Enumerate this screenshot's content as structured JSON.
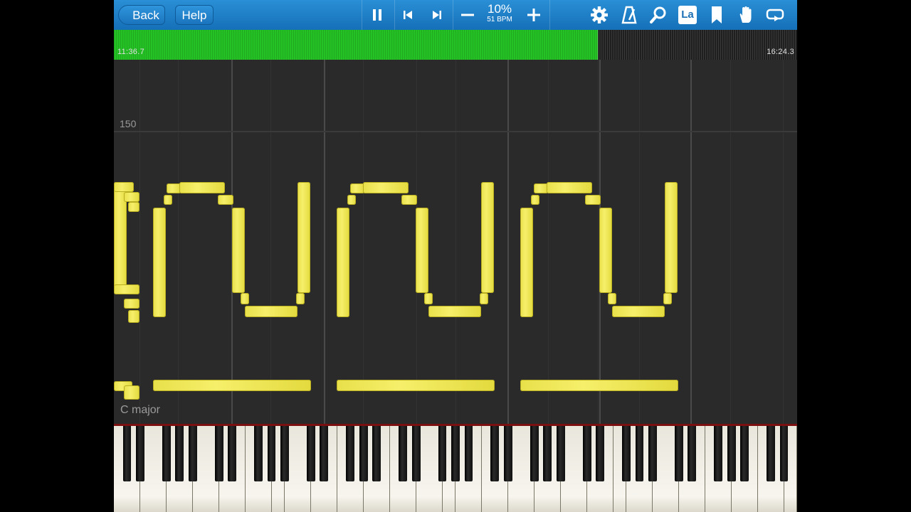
{
  "toolbar": {
    "back_label": "Back",
    "help_label": "Help",
    "speed_percent": "10%",
    "speed_bpm": "51 BPM",
    "icons": [
      "pause-icon",
      "previous-icon",
      "next-icon",
      "minus-icon",
      "plus-icon",
      "gear-icon",
      "metronome-icon",
      "magnifier-icon",
      "label-icon",
      "bookmark-icon",
      "hand-icon",
      "loop-icon"
    ],
    "label_icon_text": "La"
  },
  "progress": {
    "current_time": "11:36.7",
    "total_time": "16:24.3",
    "fraction": 0.707
  },
  "roll": {
    "measure_number": "150",
    "key_signature": "C major",
    "note_color": "#f2ea5a"
  },
  "colors": {
    "toolbar": "#1a7bc4",
    "progress_played": "#22b722",
    "background": "#2a2a2a"
  }
}
